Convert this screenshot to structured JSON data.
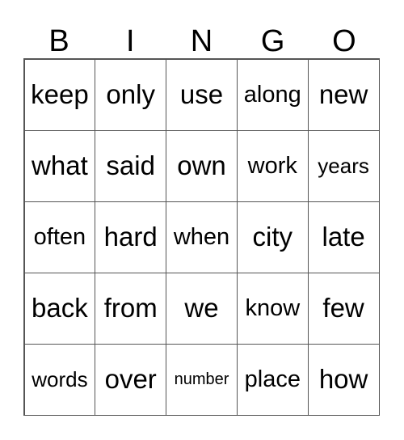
{
  "header": [
    "B",
    "I",
    "N",
    "G",
    "O"
  ],
  "cells": [
    [
      "keep",
      "only",
      "use",
      "along",
      "new"
    ],
    [
      "what",
      "said",
      "own",
      "work",
      "years"
    ],
    [
      "often",
      "hard",
      "when",
      "city",
      "late"
    ],
    [
      "back",
      "from",
      "we",
      "know",
      "few"
    ],
    [
      "words",
      "over",
      "number",
      "place",
      "how"
    ]
  ]
}
